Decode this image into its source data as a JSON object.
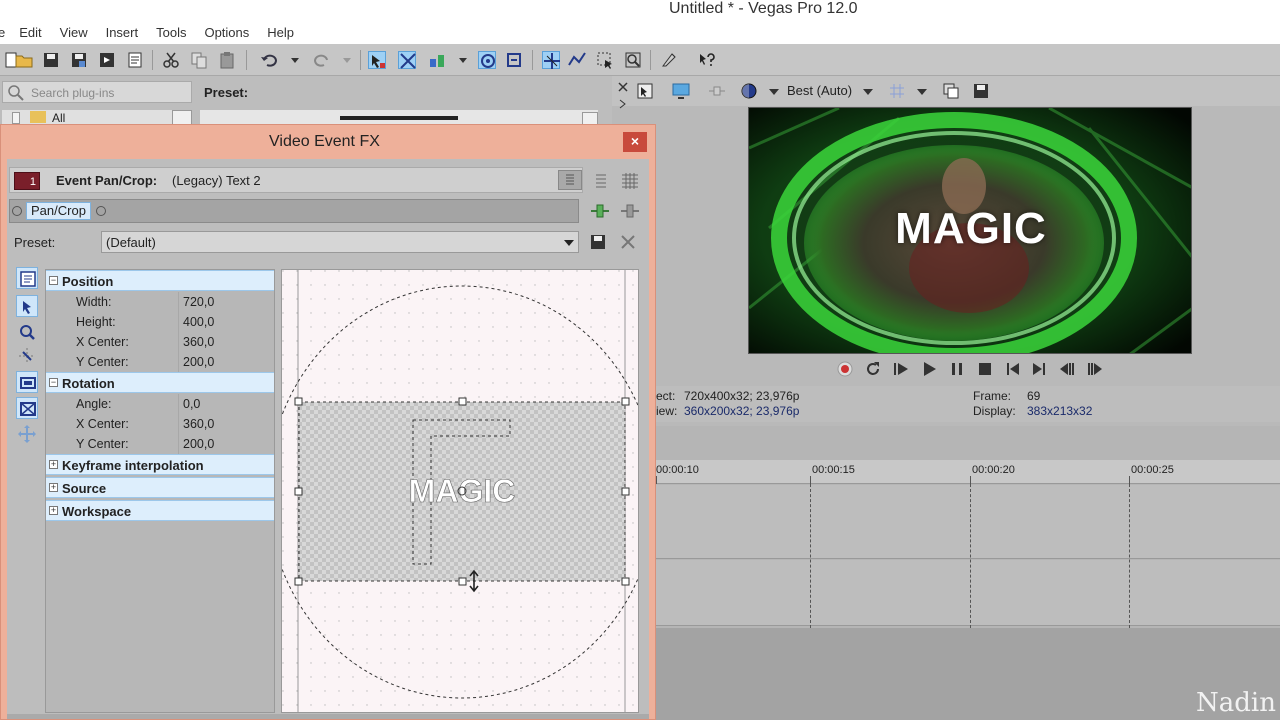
{
  "window": {
    "title": "Untitled * - Vegas Pro 12.0"
  },
  "menu": [
    "e",
    "Edit",
    "View",
    "Insert",
    "Tools",
    "Options",
    "Help"
  ],
  "plugins": {
    "search_placeholder": "Search plug-ins",
    "preset_label": "Preset:",
    "tree_item": "All"
  },
  "dialog": {
    "title": "Video Event FX",
    "close": "×",
    "fx_badge": "1",
    "fx_name": "Event Pan/Crop:",
    "fx_target": "(Legacy) Text 2",
    "chain_button": "Pan/Crop",
    "preset_label": "Preset:",
    "preset_value": "(Default)"
  },
  "properties": {
    "position": {
      "title": "Position",
      "rows": [
        {
          "label": "Width:",
          "value": "720,0"
        },
        {
          "label": "Height:",
          "value": "400,0"
        },
        {
          "label": "X Center:",
          "value": "360,0"
        },
        {
          "label": "Y Center:",
          "value": "200,0"
        }
      ]
    },
    "rotation": {
      "title": "Rotation",
      "rows": [
        {
          "label": "Angle:",
          "value": "0,0"
        },
        {
          "label": "X Center:",
          "value": "360,0"
        },
        {
          "label": "Y Center:",
          "value": "200,0"
        }
      ]
    },
    "collapsed": [
      "Keyframe interpolation",
      "Source",
      "Workspace"
    ],
    "expanded_sign": "−",
    "collapsed_sign": "+"
  },
  "canvas": {
    "text": "MAGIC"
  },
  "preview": {
    "quality": "Best (Auto)",
    "text": "MAGIC",
    "project_label": "ect:",
    "project_value": "720x400x32; 23,976p",
    "preview_label": "iew:",
    "preview_value": "360x200x32; 23,976p",
    "frame_label": "Frame:",
    "frame_value": "69",
    "display_label": "Display:",
    "display_value": "383x213x32"
  },
  "timeline": {
    "ruler": [
      "00:00:10",
      "00:00:15",
      "00:00:20",
      "00:00:25"
    ]
  },
  "watermark": "Nadin",
  "colors": {
    "dialog_frame": "#eeb09a",
    "close": "#c84a3c",
    "group_header": "#ddeefc",
    "glow": "#3bd63b",
    "fx_badge": "#7a1f2a"
  }
}
